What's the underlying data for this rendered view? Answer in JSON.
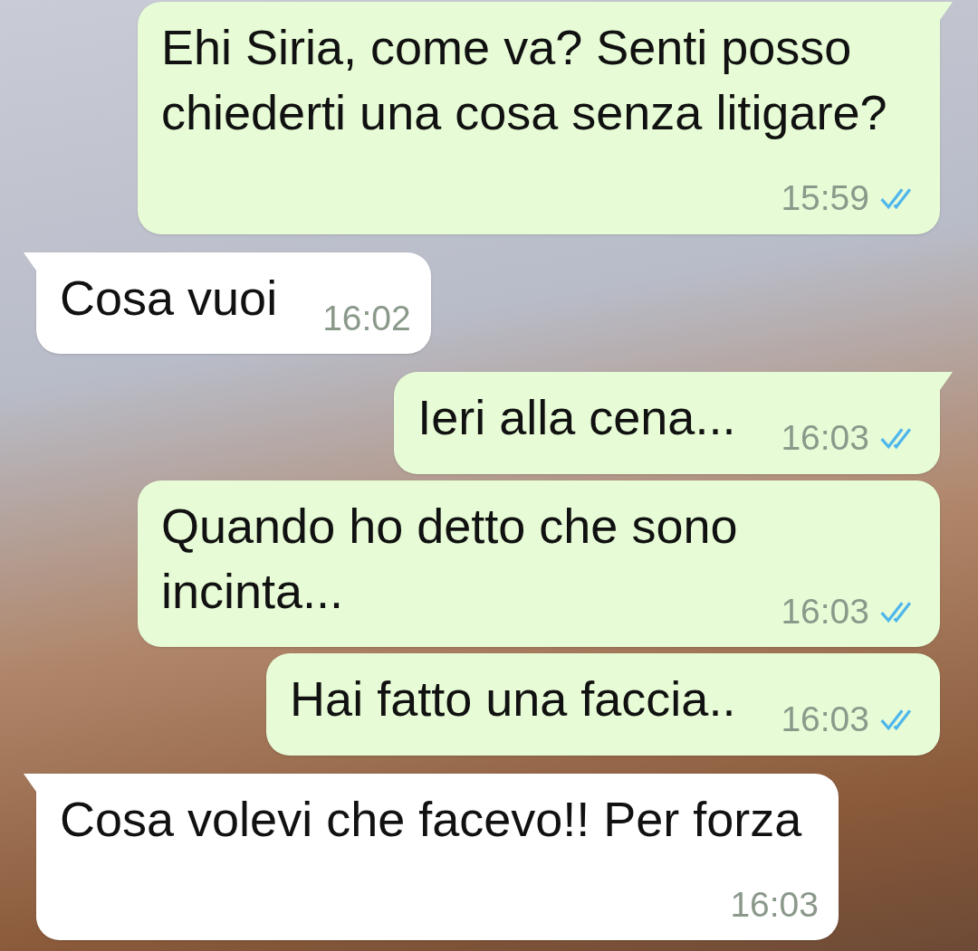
{
  "messages": [
    {
      "kind": "sent",
      "text": "Ehi Siria, come va? Senti posso chiederti una cosa senza litigare?",
      "time": "15:59",
      "read": true
    },
    {
      "kind": "received",
      "text": "Cosa vuoi",
      "time": "16:02"
    },
    {
      "kind": "sent",
      "text": "Ieri alla cena...",
      "time": "16:03",
      "read": true
    },
    {
      "kind": "sent",
      "text": "Quando ho detto che sono incinta...",
      "time": "16:03",
      "read": true
    },
    {
      "kind": "sent",
      "text": "Hai fatto una faccia..",
      "time": "16:03",
      "read": true
    },
    {
      "kind": "received",
      "text": "Cosa volevi che facevo!! Per forza",
      "time": "16:03"
    }
  ]
}
